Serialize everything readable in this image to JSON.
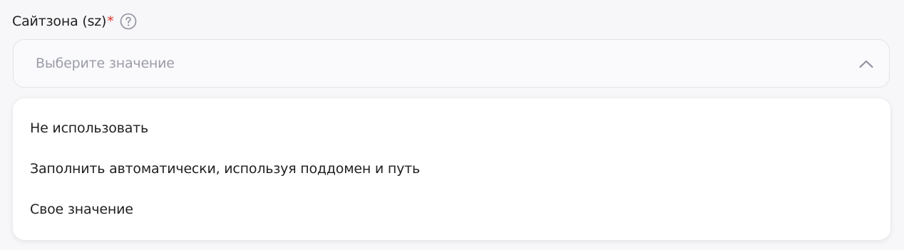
{
  "field": {
    "label": "Сайтзона (sz)",
    "required_mark": "*",
    "help_icon": "question-circle-icon",
    "placeholder": "Выберите значение",
    "chevron_icon": "chevron-up-icon"
  },
  "dropdown": {
    "options": [
      {
        "label": "Не использовать"
      },
      {
        "label": "Заполнить автоматически, используя поддомен и путь"
      },
      {
        "label": "Свое значение"
      }
    ]
  },
  "colors": {
    "required": "#e0332d",
    "placeholder": "#9a9ca8",
    "icon": "#8e909c",
    "background": "#f7f7f9"
  }
}
